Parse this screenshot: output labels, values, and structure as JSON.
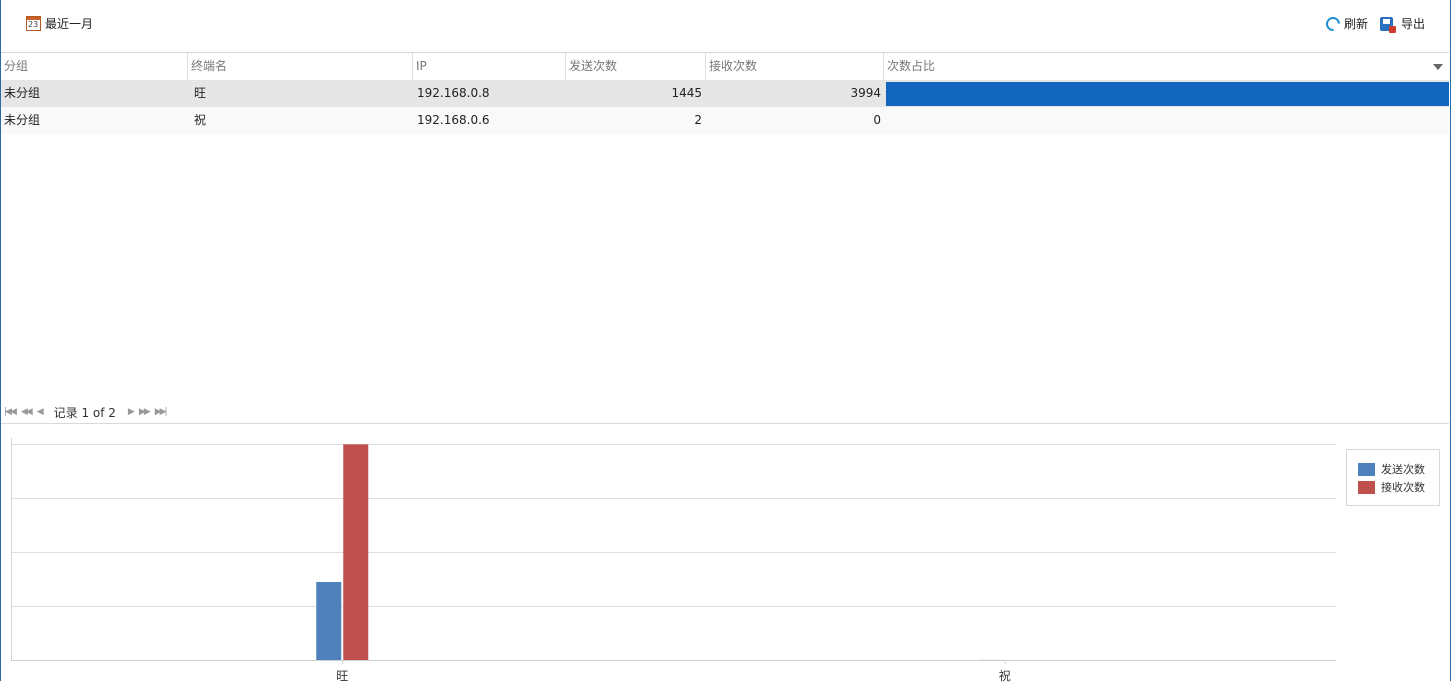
{
  "toolbar": {
    "period_label": "最近一月",
    "calendar_icon_text": "23",
    "refresh_label": "刷新",
    "export_label": "导出"
  },
  "grid": {
    "columns": [
      "分组",
      "终端名",
      "IP",
      "发送次数",
      "接收次数",
      "次数占比"
    ],
    "rows": [
      {
        "group": "未分组",
        "terminal": "旺",
        "ip": "192.168.0.8",
        "sent": "1445",
        "received": "3994",
        "ratio": 1.0
      },
      {
        "group": "未分组",
        "terminal": "祝",
        "ip": "192.168.0.6",
        "sent": "2",
        "received": "0",
        "ratio": 0.0
      }
    ],
    "accent": "#1266bd"
  },
  "pager": {
    "text": "记录 1 of 2"
  },
  "chart_data": {
    "type": "bar",
    "categories": [
      "旺",
      "祝"
    ],
    "series": [
      {
        "name": "发送次数",
        "values": [
          1445,
          2
        ],
        "color": "#4f81bd"
      },
      {
        "name": "接收次数",
        "values": [
          3994,
          0
        ],
        "color": "#c0504d"
      }
    ],
    "ylim": [
      0,
      4000
    ],
    "grid": true,
    "legend_placement": "top-right"
  }
}
